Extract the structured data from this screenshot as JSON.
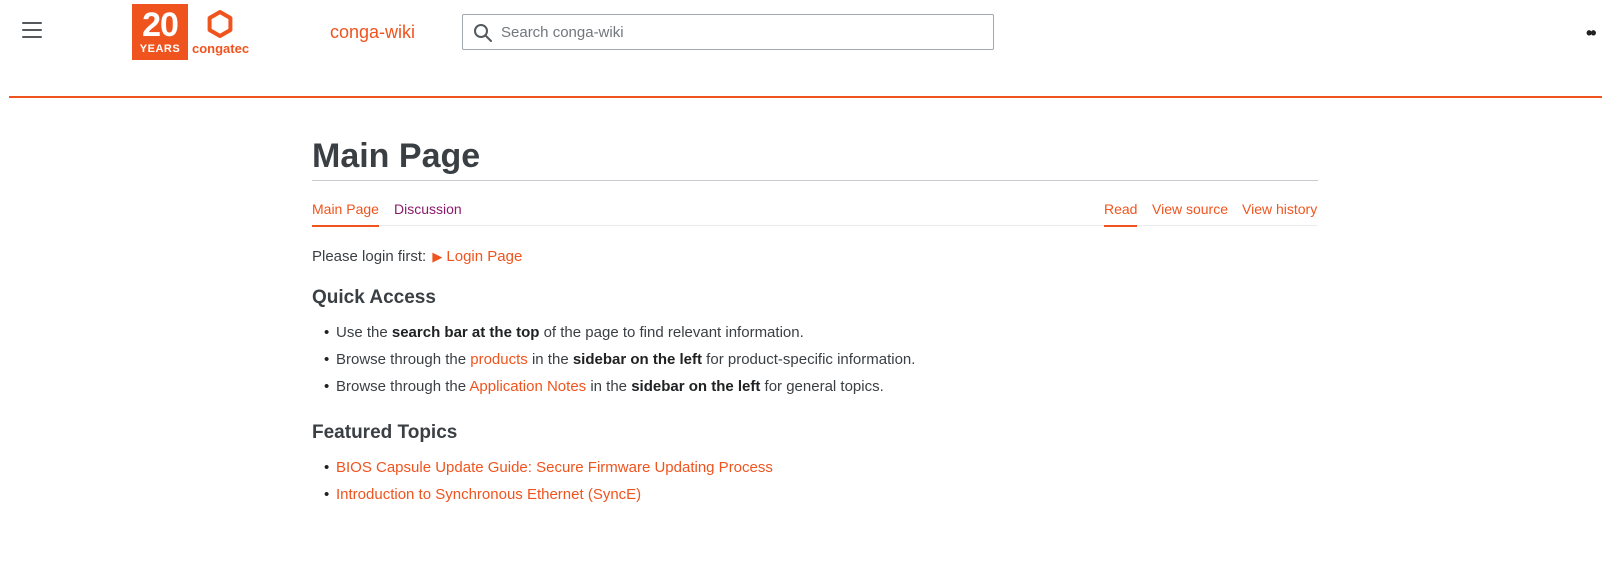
{
  "header": {
    "logo_years_number": "20",
    "logo_years_label": "YEARS",
    "logo_brand": "congatec",
    "site_name": "conga-wiki",
    "search_placeholder": "Search conga-wiki",
    "search_value": "",
    "user_menu": "••"
  },
  "colors": {
    "accent": "#f0541e",
    "discussion": "#8b1a6b",
    "text": "#3a3f44"
  },
  "page": {
    "title": "Main Page",
    "tabs_left": [
      {
        "label": "Main Page",
        "active": true
      },
      {
        "label": "Discussion",
        "active": false
      }
    ],
    "tabs_right": [
      {
        "label": "Read",
        "active": true
      },
      {
        "label": "View source",
        "active": false
      },
      {
        "label": "View history",
        "active": false
      }
    ]
  },
  "login": {
    "prefix": "Please login first:",
    "link_label": "Login Page"
  },
  "quick_access": {
    "heading": "Quick Access",
    "items": [
      {
        "t1": "Use the ",
        "b1": "search bar at the top",
        "t2": " of the page to find relevant information."
      },
      {
        "t1": "Browse through the ",
        "link": "products",
        "t2": " in the ",
        "b1": "sidebar on the left",
        "t3": " for product-specific information."
      },
      {
        "t1": "Browse through the ",
        "link": "Application Notes",
        "t2": " in the ",
        "b1": "sidebar on the left",
        "t3": " for general topics."
      }
    ]
  },
  "featured": {
    "heading": "Featured Topics",
    "items": [
      "BIOS Capsule Update Guide: Secure Firmware Updating Process",
      "Introduction to Synchronous Ethernet (SyncE)"
    ]
  }
}
